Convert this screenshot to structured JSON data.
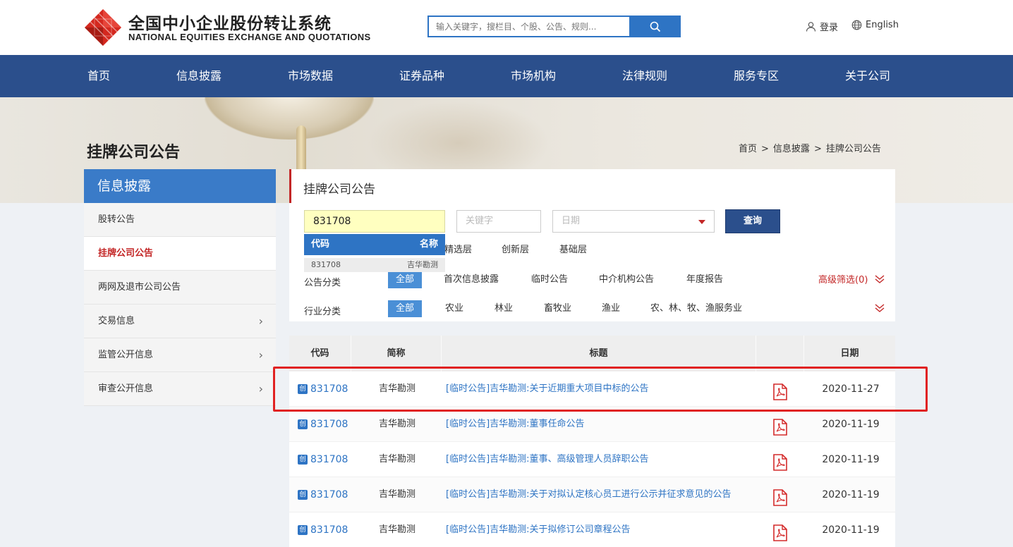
{
  "header": {
    "logo_cn": "全国中小企业股份转让系统",
    "logo_en": "NATIONAL EQUITIES EXCHANGE AND QUOTATIONS",
    "search_placeholder": "输入关键字，搜栏目、个股、公告、规则...",
    "login_label": "登录",
    "lang_label": "English",
    "brand_color": "#c32626"
  },
  "nav": {
    "items": [
      "首页",
      "信息披露",
      "市场数据",
      "证券品种",
      "市场机构",
      "法律规则",
      "服务专区",
      "关于公司"
    ],
    "bg_color": "#2b4f8c"
  },
  "page": {
    "title": "挂牌公司公告",
    "breadcrumb": [
      "首页",
      "信息披露",
      "挂牌公司公告"
    ],
    "breadcrumb_sep": ">"
  },
  "sidebar": {
    "heading": "信息披露",
    "items": [
      {
        "label": "股转公告"
      },
      {
        "label": "挂牌公司公告"
      },
      {
        "label": "两网及退市公司公告"
      },
      {
        "label": "交易信息"
      },
      {
        "label": "监管公开信息"
      },
      {
        "label": "审查公开信息"
      }
    ],
    "active_index": 1
  },
  "panel": {
    "title": "挂牌公司公告",
    "code_value": "831708",
    "keyword_placeholder": "关键字",
    "date_placeholder": "日期",
    "query_label": "查询",
    "dropdown": {
      "head_code": "代码",
      "head_name": "名称",
      "row_code": "831708",
      "row_name": "吉华勘测"
    },
    "layers": [
      "精选层",
      "创新层",
      "基础层"
    ],
    "category_label": "公告分类",
    "category_all": "全部",
    "categories": [
      "首次信息披露",
      "临时公告",
      "中介机构公告",
      "年度报告"
    ],
    "advanced_filter": "高级筛选(0)",
    "industry_label": "行业分类",
    "industry_all": "全部",
    "industries": [
      "农业",
      "林业",
      "畜牧业",
      "渔业",
      "农、林、牧、渔服务业"
    ]
  },
  "table": {
    "headers": {
      "code": "代码",
      "abbr": "简称",
      "title": "标题",
      "date": "日期"
    },
    "badge": "创",
    "rows": [
      {
        "code": "831708",
        "abbr": "吉华勘测",
        "title": "[临时公告]吉华勘测:关于近期重大项目中标的公告",
        "date": "2020-11-27"
      },
      {
        "code": "831708",
        "abbr": "吉华勘测",
        "title": "[临时公告]吉华勘测:董事任命公告",
        "date": "2020-11-19"
      },
      {
        "code": "831708",
        "abbr": "吉华勘测",
        "title": "[临时公告]吉华勘测:董事、高级管理人员辞职公告",
        "date": "2020-11-19"
      },
      {
        "code": "831708",
        "abbr": "吉华勘测",
        "title": "[临时公告]吉华勘测:关于对拟认定核心员工进行公示并征求意见的公告",
        "date": "2020-11-19"
      },
      {
        "code": "831708",
        "abbr": "吉华勘测",
        "title": "[临时公告]吉华勘测:关于拟修订公司章程公告",
        "date": "2020-11-19"
      }
    ],
    "highlighted_row": 0,
    "highlight_color": "#e02222"
  }
}
